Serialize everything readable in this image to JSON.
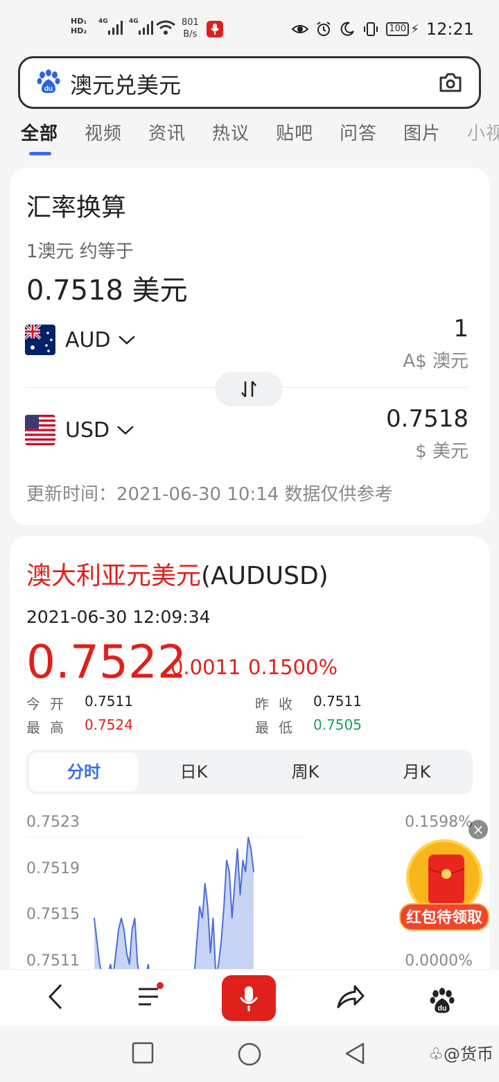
{
  "status": {
    "sim1": "HD₁",
    "sim2": "HD₂",
    "net1": "4G",
    "net2": "4G",
    "speed_value": "801",
    "speed_unit": "B/s",
    "battery": "100",
    "time": "12:21"
  },
  "search": {
    "query": "澳元兑美元"
  },
  "tabs": [
    "全部",
    "视频",
    "资讯",
    "热议",
    "贴吧",
    "问答",
    "图片",
    "小视"
  ],
  "converter": {
    "title": "汇率换算",
    "sub": "1澳元 约等于",
    "rate": "0.7518 美元",
    "from_code": "AUD",
    "from_amount": "1",
    "from_unit": "A$ 澳元",
    "to_code": "USD",
    "to_amount": "0.7518",
    "to_unit": "$ 美元",
    "update": "更新时间：2021-06-30 10:14 数据仅供参考"
  },
  "quote": {
    "pair_red": "澳大利亚元美元",
    "pair_code": "(AUDUSD)",
    "timestamp": "2021-06-30 12:09:34",
    "price": "0.7522",
    "change": "0.0011",
    "change_pct": "0.1500%",
    "open_label": "今开",
    "open": "0.7511",
    "prev_label": "昨收",
    "prev": "0.7511",
    "high_label": "最高",
    "high": "0.7524",
    "low_label": "最低",
    "low": "0.7505",
    "segments": [
      "分时",
      "日K",
      "周K",
      "月K"
    ]
  },
  "colors": {
    "red": "#e0201a",
    "green": "#17a05a",
    "blue": "#3b6ee8",
    "chart_line": "#4a6fd8",
    "chart_fill": "#c8d4f5"
  },
  "chart_data": {
    "type": "area",
    "y_left_ticks": [
      "0.7523",
      "0.7519",
      "0.7515",
      "0.7511"
    ],
    "y_right_ticks": [
      "0.1598%",
      "",
      "",
      "0.0000%"
    ],
    "ylim": [
      0.7511,
      0.7523
    ],
    "values": [
      0.7516,
      0.7514,
      0.7512,
      0.7511,
      0.751,
      0.7511,
      0.7512,
      0.7511,
      0.7513,
      0.7515,
      0.7516,
      0.7515,
      0.7513,
      0.7512,
      0.7515,
      0.7516,
      0.7512,
      0.7511,
      0.751,
      0.7511,
      0.7512,
      0.751,
      0.751,
      0.7511,
      0.751,
      0.751,
      0.751,
      0.751,
      0.751,
      0.751,
      0.751,
      0.751,
      0.751,
      0.751,
      0.751,
      0.751,
      0.751,
      0.7511,
      0.7514,
      0.7517,
      0.7516,
      0.7519,
      0.7517,
      0.7513,
      0.7516,
      0.7511,
      0.7512,
      0.7514,
      0.7517,
      0.7521,
      0.752,
      0.7516,
      0.7519,
      0.7522,
      0.7518,
      0.7521,
      0.752,
      0.7523,
      0.7522,
      0.752
    ]
  },
  "bottom": {
    "watermark": "@货币"
  }
}
